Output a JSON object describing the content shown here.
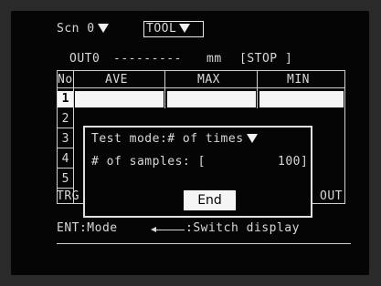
{
  "header": {
    "screen_label": "Scn 0",
    "tool_label": "TOOL"
  },
  "status": {
    "output_label": "OUT0",
    "value_text": "---------",
    "unit": "mm",
    "state": "[STOP ]"
  },
  "table": {
    "columns": [
      "No",
      "AVE",
      "MAX",
      "MIN"
    ],
    "row_numbers": [
      "1",
      "2",
      "3",
      "4",
      "5"
    ],
    "selected_row": "1",
    "trg_label": "TRG",
    "out_label": "OUT"
  },
  "dialog": {
    "mode_line": "Test mode:# of times",
    "samples_line": "# of samples: [",
    "samples_value": "100]",
    "end_button": "End"
  },
  "footer": {
    "ent_hint": "ENT:Mode",
    "switch_hint": ":Switch display"
  }
}
